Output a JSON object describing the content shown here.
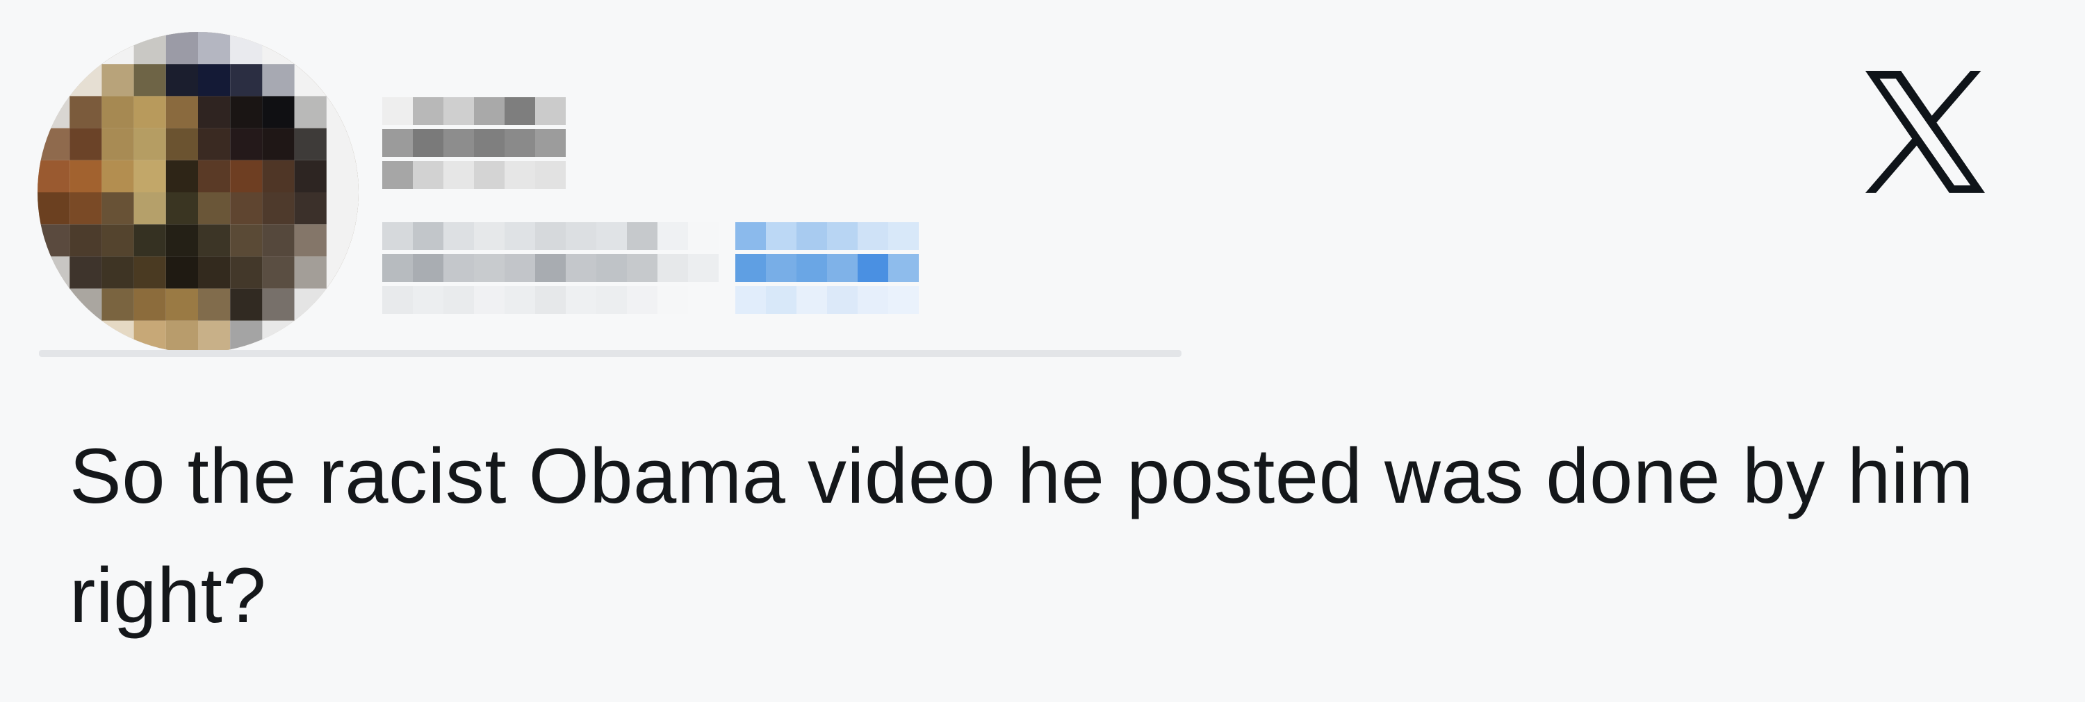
{
  "post": {
    "text": "So the racist Obama video he posted was done by him right?"
  },
  "author": {
    "display_name": "",
    "handle": "",
    "link_text": ""
  },
  "close_button": {
    "icon": "x-close-icon"
  },
  "colors": {
    "background": "#f7f8f9",
    "text": "#14171a",
    "divider": "#e3e5e8",
    "link_blue": "#4a90e2"
  }
}
